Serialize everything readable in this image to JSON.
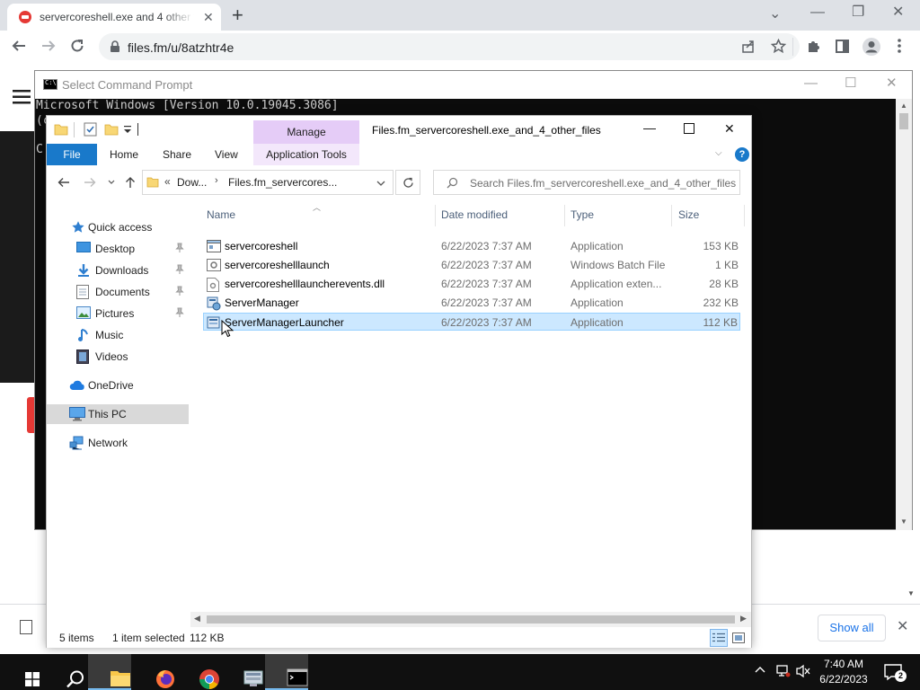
{
  "browser": {
    "tab_title": "servercoreshell.exe and 4 other files",
    "url": "files.fm/u/8atzhtr4e"
  },
  "web_page": {
    "show_all_label": "Show all"
  },
  "cmd": {
    "title": "Select Command Prompt",
    "line1": "Microsoft Windows [Version 10.0.19045.3086]",
    "line2": "(c",
    "line3": "C"
  },
  "explorer": {
    "title": "Files.fm_servercoreshell.exe_and_4_other_files",
    "manage_label": "Manage",
    "ribbon_tabs": {
      "file": "File",
      "home": "Home",
      "share": "Share",
      "view": "View",
      "application_tools": "Application Tools"
    },
    "address": {
      "overflow": "«",
      "segment1": "Dow...",
      "segment2": "Files.fm_servercores..."
    },
    "search_placeholder": "Search Files.fm_servercoreshell.exe_and_4_other_files",
    "nav": [
      {
        "label": "Quick access"
      },
      {
        "label": "Desktop"
      },
      {
        "label": "Downloads"
      },
      {
        "label": "Documents"
      },
      {
        "label": "Pictures"
      },
      {
        "label": "Music"
      },
      {
        "label": "Videos"
      },
      {
        "label": "OneDrive"
      },
      {
        "label": "This PC"
      },
      {
        "label": "Network"
      }
    ],
    "columns": {
      "name": "Name",
      "date": "Date modified",
      "type": "Type",
      "size": "Size"
    },
    "files": [
      {
        "name": "servercoreshell",
        "date": "6/22/2023 7:37 AM",
        "type": "Application",
        "size": "153 KB"
      },
      {
        "name": "servercoreshelllaunch",
        "date": "6/22/2023 7:37 AM",
        "type": "Windows Batch File",
        "size": "1 KB"
      },
      {
        "name": "servercoreshelllauncherevents.dll",
        "date": "6/22/2023 7:37 AM",
        "type": "Application exten...",
        "size": "28 KB"
      },
      {
        "name": "ServerManager",
        "date": "6/22/2023 7:37 AM",
        "type": "Application",
        "size": "232 KB"
      },
      {
        "name": "ServerManagerLauncher",
        "date": "6/22/2023 7:37 AM",
        "type": "Application",
        "size": "112 KB"
      }
    ],
    "status": {
      "items": "5 items",
      "selected": "1 item selected",
      "size": "112 KB"
    }
  },
  "taskbar": {
    "time": "7:40 AM",
    "date": "6/22/2023",
    "notification_count": "2"
  },
  "colors": {
    "accent": "#1979ca",
    "selection": "#cce8ff",
    "manage_tab": "#e5ccf7",
    "taskbar": "#101010"
  }
}
